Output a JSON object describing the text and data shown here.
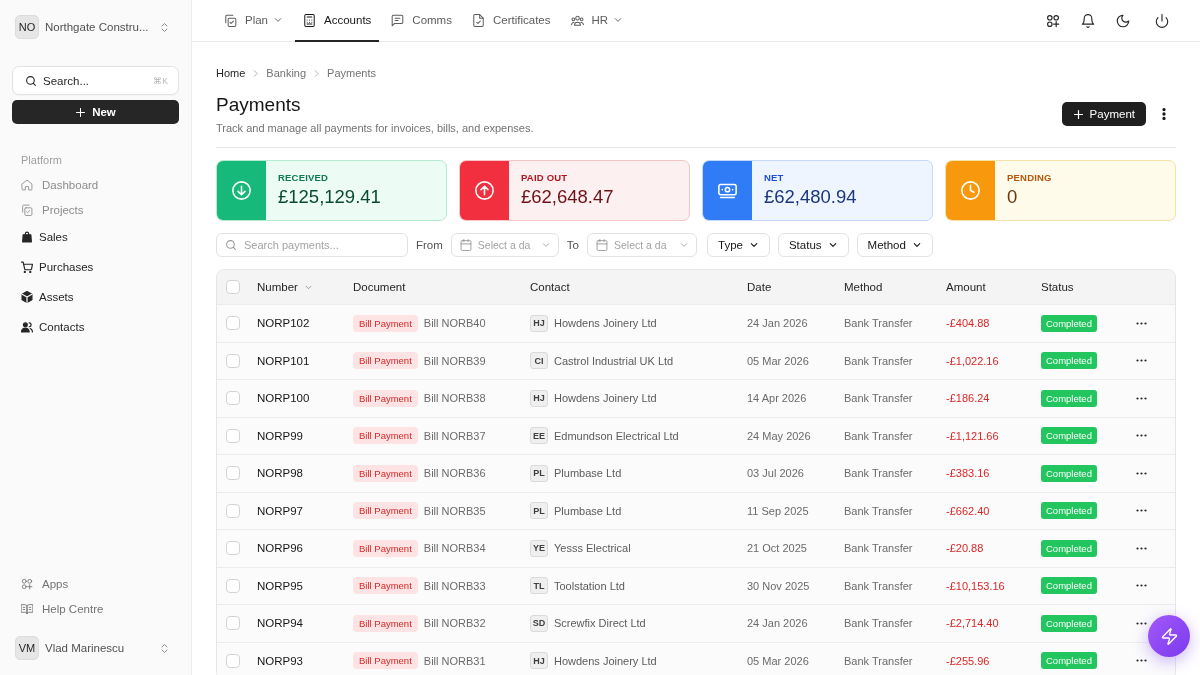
{
  "sidebar": {
    "workspace": {
      "initials": "NO",
      "name": "Northgate Constru..."
    },
    "search": {
      "label": "Search...",
      "shortcut": "⌘K"
    },
    "new_button": "New",
    "section_label": "Platform",
    "items": [
      {
        "label": "Dashboard",
        "disabled": true
      },
      {
        "label": "Projects",
        "disabled": true
      },
      {
        "label": "Sales",
        "disabled": false
      },
      {
        "label": "Purchases",
        "disabled": false
      },
      {
        "label": "Assets",
        "disabled": false
      },
      {
        "label": "Contacts",
        "disabled": false
      }
    ],
    "footer_items": [
      "Apps",
      "Help Centre"
    ],
    "user": {
      "initials": "VM",
      "name": "Vlad Marinescu"
    }
  },
  "nav": {
    "tabs": [
      {
        "label": "Plan",
        "selected": false,
        "dropdown": true
      },
      {
        "label": "Accounts",
        "selected": true,
        "dropdown": false
      },
      {
        "label": "Comms",
        "selected": false,
        "dropdown": false
      },
      {
        "label": "Certificates",
        "selected": false,
        "dropdown": false
      },
      {
        "label": "HR",
        "selected": false,
        "dropdown": true
      }
    ]
  },
  "breadcrumb": [
    "Home",
    "Banking",
    "Payments"
  ],
  "page": {
    "title": "Payments",
    "subtitle": "Track and manage all payments for invoices, bills, and expenses.",
    "action_button": "Payment"
  },
  "summary_cards": [
    {
      "kind": "received",
      "label": "RECEIVED",
      "value": "£125,129.41"
    },
    {
      "kind": "paid_out",
      "label": "PAID OUT",
      "value": "£62,648.47"
    },
    {
      "kind": "net",
      "label": "NET",
      "value": "£62,480.94"
    },
    {
      "kind": "pending",
      "label": "PENDING",
      "value": "0"
    }
  ],
  "filters": {
    "search": {
      "placeholder": "Search payments..."
    },
    "from": {
      "label": "From",
      "placeholder": "Select a da"
    },
    "to": {
      "label": "To",
      "placeholder": "Select a da"
    },
    "dropdowns": [
      "Type",
      "Status",
      "Method"
    ]
  },
  "table": {
    "header_checkbox": {
      "checked": false
    },
    "columns": [
      {
        "label": "Number",
        "sorted": true
      },
      {
        "label": "Document",
        "sorted": false
      },
      {
        "label": "Contact",
        "sorted": false
      },
      {
        "label": "Date",
        "sorted": false
      },
      {
        "label": "Method",
        "sorted": false
      },
      {
        "label": "Amount",
        "sorted": false
      },
      {
        "label": "Status",
        "sorted": false
      }
    ],
    "rows": [
      {
        "checked": false,
        "number": "NORP102",
        "document_type": "Bill Payment",
        "document_ref": "Bill NORB40",
        "contact_initials": "HJ",
        "contact_name": "Howdens Joinery Ltd",
        "date": "24 Jan 2026",
        "method": "Bank Transfer",
        "amount": "-£404.88",
        "status": "Completed"
      },
      {
        "checked": false,
        "number": "NORP101",
        "document_type": "Bill Payment",
        "document_ref": "Bill NORB39",
        "contact_initials": "CI",
        "contact_name": "Castrol Industrial UK Ltd",
        "date": "05 Mar 2026",
        "method": "Bank Transfer",
        "amount": "-£1,022.16",
        "status": "Completed"
      },
      {
        "checked": false,
        "number": "NORP100",
        "document_type": "Bill Payment",
        "document_ref": "Bill NORB38",
        "contact_initials": "HJ",
        "contact_name": "Howdens Joinery Ltd",
        "date": "14 Apr 2026",
        "method": "Bank Transfer",
        "amount": "-£186.24",
        "status": "Completed"
      },
      {
        "checked": false,
        "number": "NORP99",
        "document_type": "Bill Payment",
        "document_ref": "Bill NORB37",
        "contact_initials": "EE",
        "contact_name": "Edmundson Electrical Ltd",
        "date": "24 May 2026",
        "method": "Bank Transfer",
        "amount": "-£1,121.66",
        "status": "Completed"
      },
      {
        "checked": false,
        "number": "NORP98",
        "document_type": "Bill Payment",
        "document_ref": "Bill NORB36",
        "contact_initials": "PL",
        "contact_name": "Plumbase Ltd",
        "date": "03 Jul 2026",
        "method": "Bank Transfer",
        "amount": "-£383.16",
        "status": "Completed"
      },
      {
        "checked": false,
        "number": "NORP97",
        "document_type": "Bill Payment",
        "document_ref": "Bill NORB35",
        "contact_initials": "PL",
        "contact_name": "Plumbase Ltd",
        "date": "11 Sep 2025",
        "method": "Bank Transfer",
        "amount": "-£662.40",
        "status": "Completed"
      },
      {
        "checked": false,
        "number": "NORP96",
        "document_type": "Bill Payment",
        "document_ref": "Bill NORB34",
        "contact_initials": "YE",
        "contact_name": "Yesss Electrical",
        "date": "21 Oct 2025",
        "method": "Bank Transfer",
        "amount": "-£20.88",
        "status": "Completed"
      },
      {
        "checked": false,
        "number": "NORP95",
        "document_type": "Bill Payment",
        "document_ref": "Bill NORB33",
        "contact_initials": "TL",
        "contact_name": "Toolstation Ltd",
        "date": "30 Nov 2025",
        "method": "Bank Transfer",
        "amount": "-£10,153.16",
        "status": "Completed"
      },
      {
        "checked": false,
        "number": "NORP94",
        "document_type": "Bill Payment",
        "document_ref": "Bill NORB32",
        "contact_initials": "SD",
        "contact_name": "Screwfix Direct Ltd",
        "date": "24 Jan 2026",
        "method": "Bank Transfer",
        "amount": "-£2,714.40",
        "status": "Completed"
      },
      {
        "checked": false,
        "number": "NORP93",
        "document_type": "Bill Payment",
        "document_ref": "Bill NORB31",
        "contact_initials": "HJ",
        "contact_name": "Howdens Joinery Ltd",
        "date": "05 Mar 2026",
        "method": "Bank Transfer",
        "amount": "-£255.96",
        "status": "Completed"
      }
    ]
  }
}
